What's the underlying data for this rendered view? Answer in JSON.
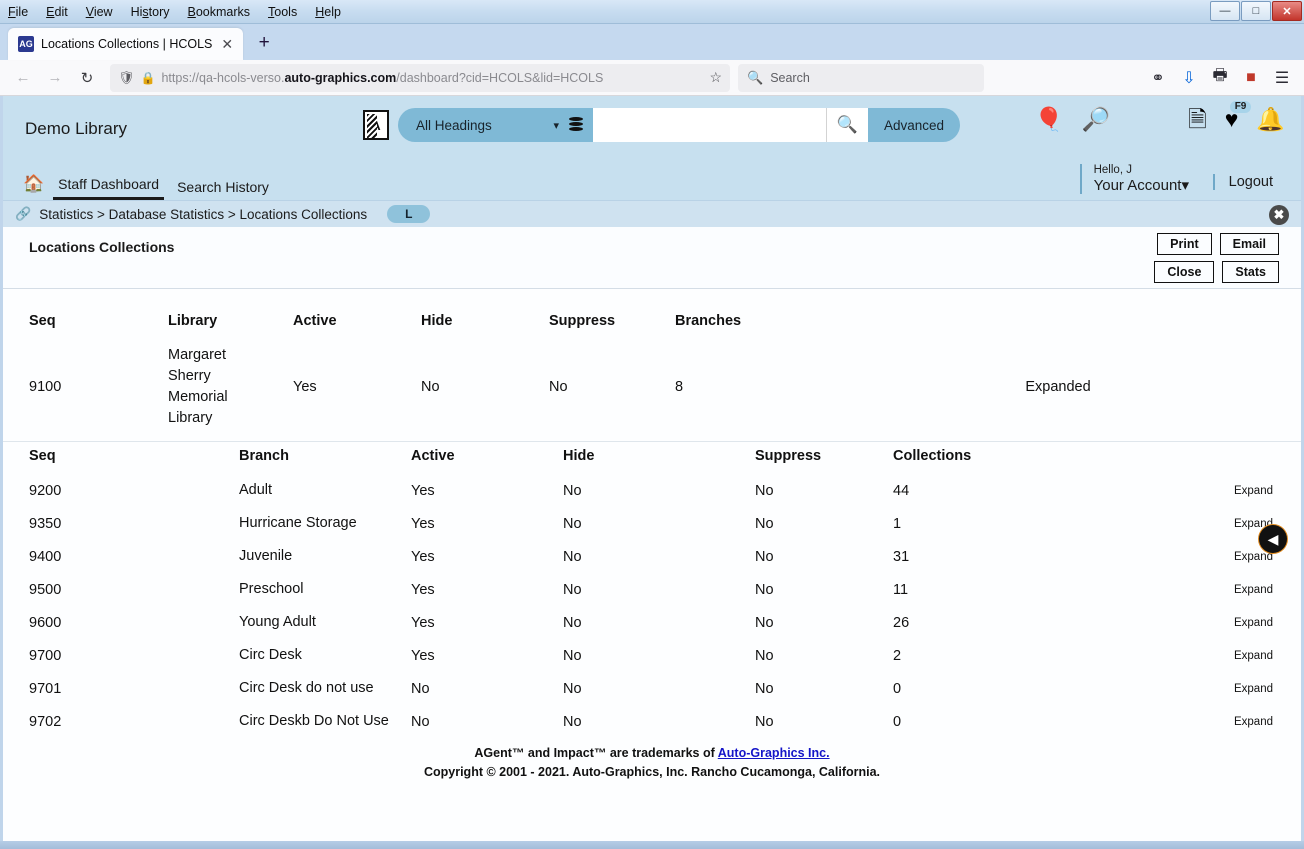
{
  "browser": {
    "menubar": [
      "File",
      "Edit",
      "View",
      "History",
      "Bookmarks",
      "Tools",
      "Help"
    ],
    "window_controls": {
      "minimize": "—",
      "maximize": "□",
      "close": "✕"
    },
    "tab": {
      "title": "Locations Collections | HCOLS",
      "favicon_label": "AG",
      "close_label": "✕"
    },
    "newtab_label": "+",
    "nav": {
      "back": "←",
      "forward": "→",
      "reload": "↻"
    },
    "url": {
      "prefix": "https://qa-hcols-verso.",
      "domain": "auto-graphics.com",
      "suffix": "/dashboard?cid=HCOLS&lid=HCOLS",
      "shield_icon": "shield-icon",
      "lock_icon": "lock-icon",
      "bookmark_icon": "star-icon"
    },
    "search": {
      "placeholder": "Search",
      "value": ""
    },
    "toolbar_icons": [
      "pocket-icon",
      "downloads-icon",
      "printer-icon",
      "extension-icon",
      "hamburger-menu-icon"
    ]
  },
  "app": {
    "brand": "Demo Library",
    "search": {
      "language_icon": "language-toggle-icon",
      "heading_select": "All Headings",
      "db_icon": "database-icon",
      "input_value": "",
      "input_placeholder": "",
      "go_label": "🔍",
      "advanced_label": "Advanced"
    },
    "header_icons": [
      {
        "name": "balloon-icon",
        "glyph": "🎈",
        "badge": ""
      },
      {
        "name": "explore-search-icon",
        "glyph": "🗺",
        "badge": ""
      },
      {
        "name": "my-lists-icon",
        "glyph": "📃",
        "badge": ""
      },
      {
        "name": "favorites-heart-icon",
        "glyph": "♥",
        "badge": "F9"
      },
      {
        "name": "notifications-bell-icon",
        "glyph": "🔔",
        "badge": ""
      }
    ],
    "nav": {
      "home_icon": "home-icon",
      "links": [
        {
          "label": "Staff Dashboard",
          "active": true
        },
        {
          "label": "Search History",
          "active": false
        }
      ]
    },
    "account": {
      "hello": "Hello, J",
      "label": "Your Account",
      "chevron": "⌄"
    },
    "logout": "Logout",
    "breadcrumb": {
      "link_icon": "link-icon",
      "text": "Statistics > Database Statistics > Locations Collections",
      "pill": "L",
      "close_label": "✖"
    },
    "panel": {
      "title": "Locations Collections",
      "buttons": [
        [
          "Print",
          "Email"
        ],
        [
          "Close",
          "Stats"
        ]
      ]
    },
    "library_table": {
      "columns": [
        "Seq",
        "Library",
        "Active",
        "Hide",
        "Suppress",
        "Branches",
        ""
      ],
      "rows": [
        {
          "seq": "9100",
          "library": "Margaret Sherry Memorial Library",
          "active": "Yes",
          "hide": "No",
          "suppress": "No",
          "branches": "8",
          "action": "Expanded"
        }
      ]
    },
    "branch_table": {
      "columns": [
        "Seq",
        "Branch",
        "Active",
        "Hide",
        "Suppress",
        "Collections",
        ""
      ],
      "rows": [
        {
          "seq": "9200",
          "branch": "Adult",
          "active": "Yes",
          "hide": "No",
          "suppress": "No",
          "collections": "44",
          "action": "Expand"
        },
        {
          "seq": "9350",
          "branch": "Hurricane Storage",
          "active": "Yes",
          "hide": "No",
          "suppress": "No",
          "collections": "1",
          "action": "Expand"
        },
        {
          "seq": "9400",
          "branch": "Juvenile",
          "active": "Yes",
          "hide": "No",
          "suppress": "No",
          "collections": "31",
          "action": "Expand"
        },
        {
          "seq": "9500",
          "branch": "Preschool",
          "active": "Yes",
          "hide": "No",
          "suppress": "No",
          "collections": "11",
          "action": "Expand"
        },
        {
          "seq": "9600",
          "branch": "Young Adult",
          "active": "Yes",
          "hide": "No",
          "suppress": "No",
          "collections": "26",
          "action": "Expand"
        },
        {
          "seq": "9700",
          "branch": "Circ Desk",
          "active": "Yes",
          "hide": "No",
          "suppress": "No",
          "collections": "2",
          "action": "Expand"
        },
        {
          "seq": "9701",
          "branch": "Circ Desk do not use",
          "active": "No",
          "hide": "No",
          "suppress": "No",
          "collections": "0",
          "action": "Expand"
        },
        {
          "seq": "9702",
          "branch": "Circ Deskb Do Not Use",
          "active": "No",
          "hide": "No",
          "suppress": "No",
          "collections": "0",
          "action": "Expand"
        }
      ]
    },
    "collapse_arrow": "◀",
    "footer": {
      "line1_pre": "AGent™ and Impact™ are trademarks of ",
      "line1_link": "Auto-Graphics Inc.",
      "line2": "Copyright © 2001 - 2021. Auto-Graphics, Inc. Rancho Cucamonga, California."
    }
  },
  "colors": {
    "app_header": "#c7e0ef",
    "accent": "#7fb9d6",
    "breadcrumb_bar": "#cfe2f0",
    "link": "#1414c8"
  }
}
